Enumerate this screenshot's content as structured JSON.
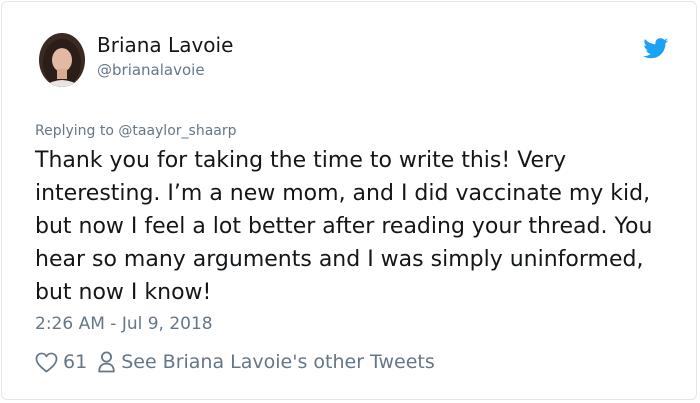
{
  "author": {
    "display_name": "Briana Lavoie",
    "handle": "@brianalavoie"
  },
  "tweet": {
    "replying_to": "Replying to @taaylor_shaarp",
    "text": "Thank you for taking the time to write this! Very interesting. I’m a new mom, and I did vaccinate my kid, but now I feel a lot better after reading your thread. You hear so many arguments and I was simply uninformed, but now I know!",
    "timestamp": "2:26 AM - Jul 9, 2018",
    "like_count": "61",
    "other_tweets_link": "See Briana Lavoie's other Tweets"
  },
  "icons": {
    "brand": "twitter-bird-icon",
    "like": "heart-icon",
    "profile": "person-icon"
  },
  "colors": {
    "twitter_blue": "#1da1f2",
    "text_primary": "#14171a",
    "text_secondary": "#657786",
    "border": "#e1e8ed"
  }
}
